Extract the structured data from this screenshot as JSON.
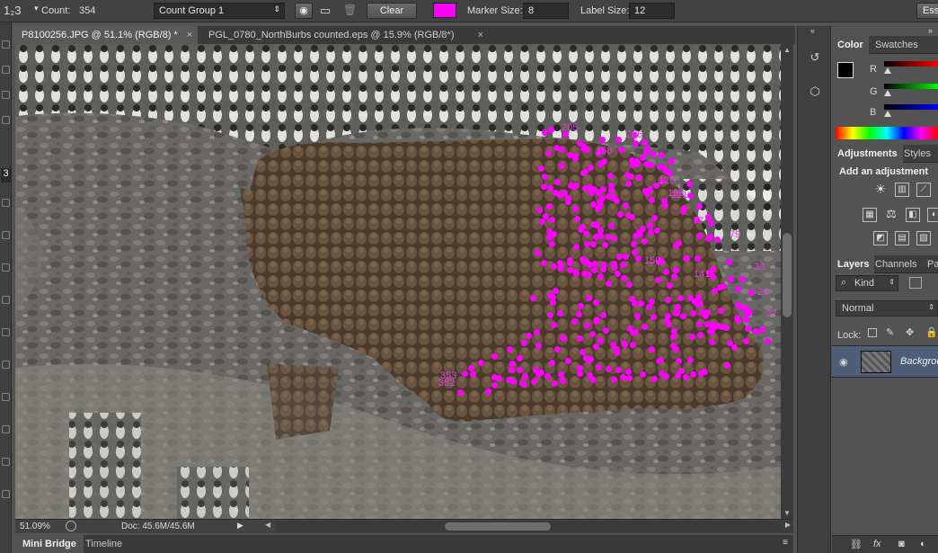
{
  "options_bar": {
    "tool_glyph": "1₂3",
    "count_label": "Count:",
    "count_value": "354",
    "count_group": "Count Group 1",
    "clear_label": "Clear",
    "marker_color": "#ff00ff",
    "marker_size_label": "Marker Size:",
    "marker_size_value": "8",
    "label_size_label": "Label Size:",
    "label_size_value": "12",
    "workspace_label": "Ess"
  },
  "document_tabs": [
    {
      "label": "P8100256.JPG @ 51.1% (RGB/8) *",
      "active": true
    },
    {
      "label": "PGL_0780_NorthBurbs counted.eps @ 15.9% (RGB/8*)",
      "active": false
    }
  ],
  "status_bar": {
    "zoom": "51.09%",
    "doc_info": "Doc: 45.6M/45.6M"
  },
  "bottom_tabs": [
    "Mini Bridge",
    "Timeline"
  ],
  "color_panel": {
    "tabs": [
      "Color",
      "Swatches"
    ],
    "channels": [
      "R",
      "G",
      "B"
    ]
  },
  "adjustments_panel": {
    "tabs": [
      "Adjustments",
      "Styles"
    ],
    "heading": "Add an adjustment"
  },
  "layers_panel": {
    "tabs": [
      "Layers",
      "Channels",
      "Pa"
    ],
    "filter_kind": "Kind",
    "blend_mode": "Normal",
    "lock_label": "Lock:",
    "layer_name": "Backgrou"
  },
  "count_labels": [
    "205",
    "206",
    "120",
    "138",
    "121",
    "77",
    "79",
    "30",
    "27",
    "26",
    "353",
    "352",
    "353",
    "158",
    "150",
    "141"
  ]
}
